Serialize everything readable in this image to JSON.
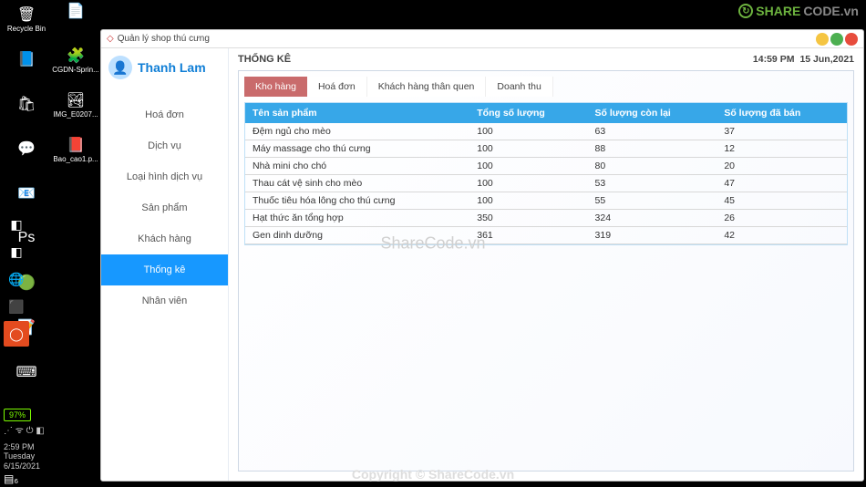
{
  "desktop": {
    "icons_col1": [
      {
        "glyph": "🗑",
        "label": "Recycle Bin"
      },
      {
        "glyph": "📘",
        "label": ""
      },
      {
        "glyph": "🛍",
        "label": ""
      },
      {
        "glyph": "💬",
        "label": ""
      },
      {
        "glyph": "📧",
        "label": ""
      },
      {
        "glyph": "Ps",
        "label": ""
      },
      {
        "glyph": "🟢",
        "label": ""
      },
      {
        "glyph": "📝",
        "label": ""
      },
      {
        "glyph": "⌨",
        "label": ""
      }
    ],
    "icons_col2": [
      {
        "glyph": "📄",
        "label": ""
      },
      {
        "glyph": "🧩",
        "label": "CGDN-Sprin..."
      },
      {
        "glyph": "🏞",
        "label": "IMG_E0207..."
      },
      {
        "glyph": "📕",
        "label": "Bao_cao1.p..."
      }
    ],
    "leftbar": [
      "◧",
      "◧",
      "🌐",
      "⬛",
      "◯"
    ],
    "battery": "97%",
    "tray": "⋰ ᯤ ⏻ ◧",
    "clock_time": "2:59 PM",
    "clock_day": "Tuesday",
    "clock_date": "6/15/2021",
    "start": "▤₆"
  },
  "window": {
    "title": "Quản lý shop thú cưng",
    "user": "Thanh Lam"
  },
  "nav": {
    "items": [
      "Hoá đơn",
      "Dịch vụ",
      "Loại hình dịch vụ",
      "Sản phẩm",
      "Khách hàng",
      "Thống kê",
      "Nhân viên"
    ],
    "active_index": 5
  },
  "header": {
    "title": "THỐNG KÊ",
    "time": "14:59 PM",
    "date": "15 Jun,2021"
  },
  "tabs": {
    "items": [
      "Kho hàng",
      "Hoá đơn",
      "Khách hàng thân quen",
      "Doanh thu"
    ],
    "active_index": 0
  },
  "table": {
    "columns": [
      "Tên sản phẩm",
      "Tổng số lượng",
      "Số lượng còn lại",
      "Số lượng đã bán"
    ],
    "rows": [
      [
        "Đệm ngủ cho mèo",
        "100",
        "63",
        "37"
      ],
      [
        "Máy massage cho thú cưng",
        "100",
        "88",
        "12"
      ],
      [
        "Nhà mini cho chó",
        "100",
        "80",
        "20"
      ],
      [
        "Thau cát vệ sinh cho mèo",
        "100",
        "53",
        "47"
      ],
      [
        "Thuốc tiêu hóa lông cho thú cưng",
        "100",
        "55",
        "45"
      ],
      [
        "Hạt thức ăn tổng hợp",
        "350",
        "324",
        "26"
      ],
      [
        "Gen dinh dưỡng",
        "361",
        "319",
        "42"
      ]
    ]
  },
  "watermarks": {
    "center": "ShareCode.vn",
    "bottom": "Copyright © ShareCode.vn",
    "top_a": "SHARE",
    "top_b": "CODE.vn"
  }
}
